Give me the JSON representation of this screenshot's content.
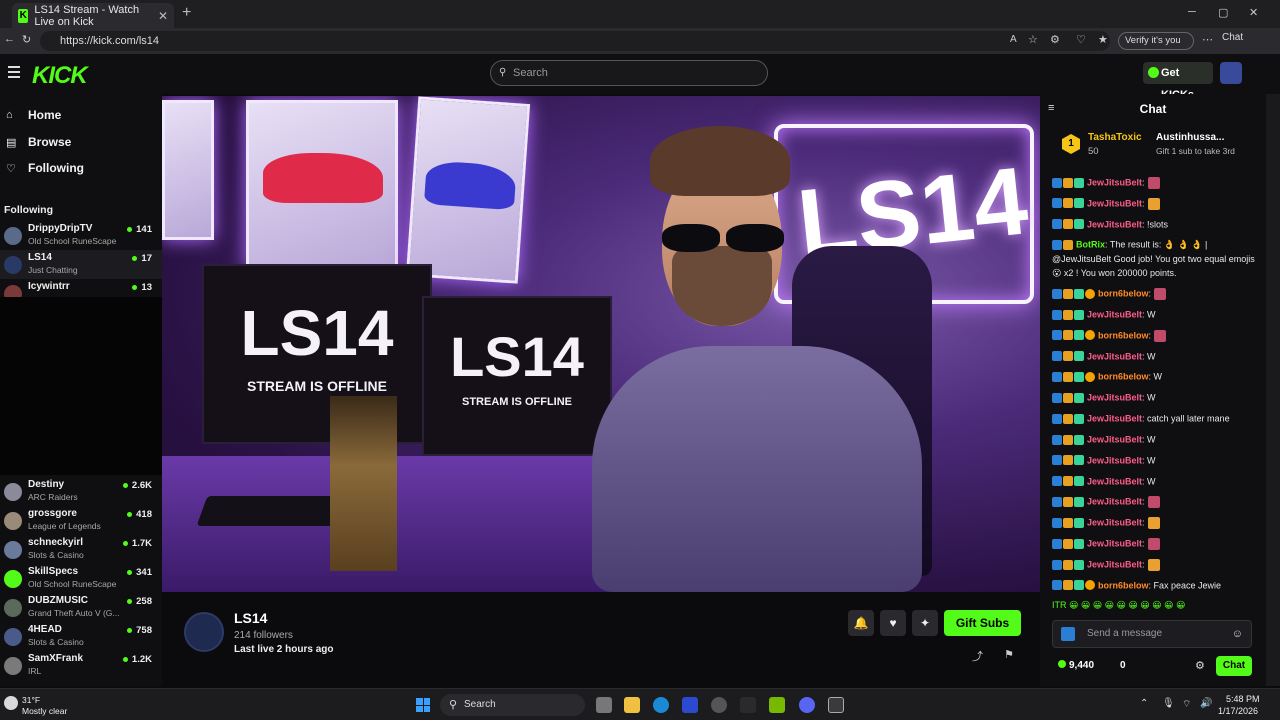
{
  "browser": {
    "tab_title": "LS14 Stream - Watch Live on Kick",
    "tab_close": "✕",
    "new_tab": "+",
    "url": "https://kick.com/ls14",
    "verify_label": "Verify it's you",
    "chat_label": "Chat",
    "win_min": "─",
    "win_max": "▢",
    "win_close": "✕"
  },
  "kick": {
    "logo": "KICK",
    "search_placeholder": "Search",
    "get_kicks": "Get KICKs",
    "accent": "#53fc18"
  },
  "sidebar": {
    "nav": [
      {
        "label": "Home",
        "icon": "home-icon"
      },
      {
        "label": "Browse",
        "icon": "browse-icon"
      },
      {
        "label": "Following",
        "icon": "heart-icon"
      }
    ],
    "following_heading": "Following",
    "following": [
      {
        "name": "DrippyDripTV",
        "game": "Old School RuneScape",
        "viewers": "141"
      },
      {
        "name": "LS14",
        "game": "Just Chatting",
        "viewers": "17"
      },
      {
        "name": "Icywintrr",
        "game": "",
        "viewers": "13"
      }
    ],
    "recommended": [
      {
        "name": "Destiny",
        "game": "ARC Raiders",
        "viewers": "2.6K"
      },
      {
        "name": "grossgore",
        "game": "League of Legends",
        "viewers": "418"
      },
      {
        "name": "schneckyirl",
        "game": "Slots & Casino",
        "viewers": "1.7K"
      },
      {
        "name": "SkillSpecs",
        "game": "Old School RuneScape",
        "viewers": "341"
      },
      {
        "name": "DUBZMUSIC",
        "game": "Grand Theft Auto V (G...",
        "viewers": "258"
      },
      {
        "name": "4HEAD",
        "game": "Slots & Casino",
        "viewers": "758"
      },
      {
        "name": "SamXFrank",
        "game": "IRL",
        "viewers": "1.2K"
      }
    ]
  },
  "video": {
    "sign_text": "LS14",
    "monitor_big": "LS14",
    "monitor_small": "STREAM IS OFFLINE"
  },
  "channel": {
    "name": "LS14",
    "followers": "214 followers",
    "last_live": "Last live 2 hours ago",
    "gift_subs": "Gift Subs"
  },
  "chat": {
    "title": "Chat",
    "pinned": {
      "rank": "1",
      "user": "TashaToxic",
      "amount": "50",
      "gifter": "Austinhussa...",
      "gifter_count": "1",
      "note": "Gift 1 sub to take 3rd"
    },
    "messages": [
      {
        "user": "JewJitsuBelt",
        "color": "#ff5c8a",
        "text": ":",
        "emote": true,
        "badges": 3
      },
      {
        "user": "JewJitsuBelt",
        "color": "#ff5c8a",
        "text": ":",
        "emote": true,
        "badges": 3
      },
      {
        "user": "JewJitsuBelt",
        "color": "#ff5c8a",
        "text": ": !slots",
        "emote": false,
        "badges": 3
      },
      {
        "user": "BotRix",
        "color": "#53fc18",
        "text": ": The result is: 👌 👌 👌 | @JewJitsuBelt Good job! You got two equal emojis 😮 x2 ! You won 200000 points.",
        "emote": false,
        "badges": 2
      },
      {
        "user": "born6below",
        "color": "#ff8a2a",
        "text": ":",
        "emote": true,
        "badges": 4
      },
      {
        "user": "JewJitsuBelt",
        "color": "#ff5c8a",
        "text": ": W",
        "emote": false,
        "badges": 3
      },
      {
        "user": "born6below",
        "color": "#ff8a2a",
        "text": ":",
        "emote": true,
        "badges": 4
      },
      {
        "user": "JewJitsuBelt",
        "color": "#ff5c8a",
        "text": ": W",
        "emote": false,
        "badges": 3
      },
      {
        "user": "born6below",
        "color": "#ff8a2a",
        "text": ": W",
        "emote": false,
        "badges": 4
      },
      {
        "user": "JewJitsuBelt",
        "color": "#ff5c8a",
        "text": ": W",
        "emote": false,
        "badges": 3
      },
      {
        "user": "JewJitsuBelt",
        "color": "#ff5c8a",
        "text": ": catch yall later mane",
        "emote": false,
        "badges": 3
      },
      {
        "user": "JewJitsuBelt",
        "color": "#ff5c8a",
        "text": ": W",
        "emote": false,
        "badges": 3
      },
      {
        "user": "JewJitsuBelt",
        "color": "#ff5c8a",
        "text": ": W",
        "emote": false,
        "badges": 3
      },
      {
        "user": "JewJitsuBelt",
        "color": "#ff5c8a",
        "text": ": W",
        "emote": false,
        "badges": 3
      },
      {
        "user": "JewJitsuBelt",
        "color": "#ff5c8a",
        "text": ":",
        "emote": true,
        "badges": 3
      },
      {
        "user": "JewJitsuBelt",
        "color": "#ff5c8a",
        "text": ":",
        "emote": true,
        "badges": 3
      },
      {
        "user": "JewJitsuBelt",
        "color": "#ff5c8a",
        "text": ":",
        "emote": true,
        "badges": 3
      },
      {
        "user": "JewJitsuBelt",
        "color": "#ff5c8a",
        "text": ":",
        "emote": true,
        "badges": 3
      },
      {
        "user": "born6below",
        "color": "#ff8a2a",
        "text": ": Fax peace Jewie",
        "emote": false,
        "badges": 4
      }
    ],
    "emote_bar": "ITR 😀 😀 😀 😀 😀 😀 😀 😀 😀 😀",
    "input_placeholder": "Send a message",
    "kicks_balance": "9,440",
    "box_count": "0",
    "send_label": "Chat"
  },
  "taskbar": {
    "temp": "31°F",
    "weather": "Mostly clear",
    "search": "Search",
    "time": "5:48 PM",
    "date": "1/17/2026"
  }
}
